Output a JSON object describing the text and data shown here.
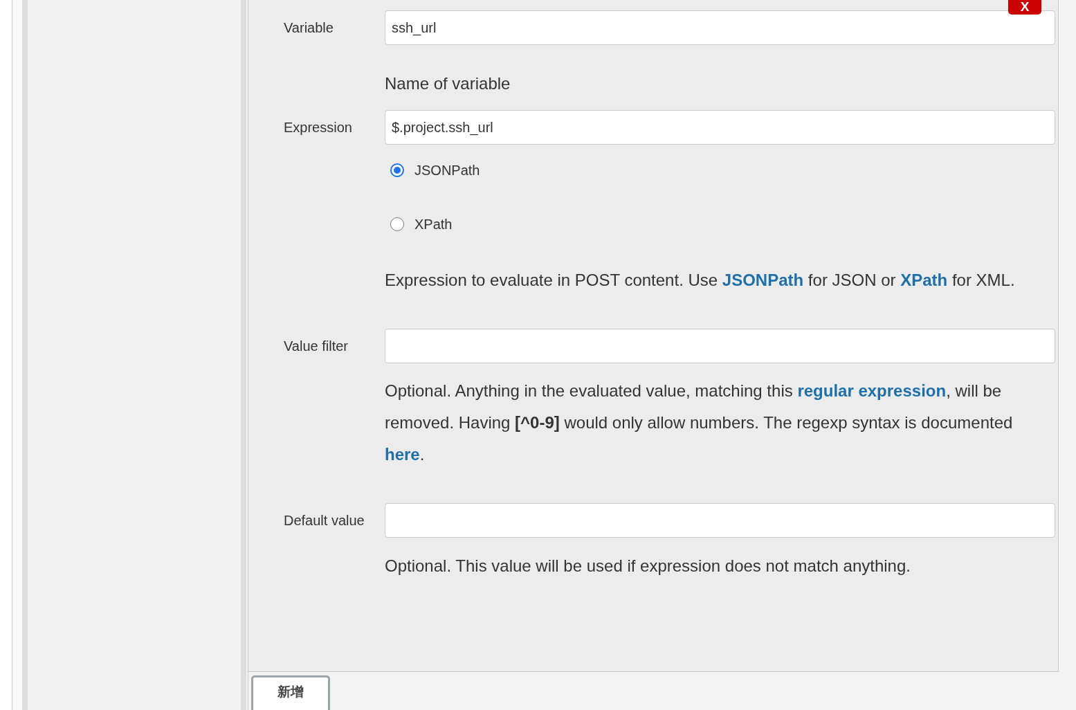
{
  "delete_button": {
    "label": "X"
  },
  "fields": [
    {
      "label": "Variable",
      "value": "ssh_url",
      "help": [
        {
          "kind": "text",
          "text": "Name of variable"
        }
      ]
    },
    {
      "label": "Expression",
      "value": "$.project.ssh_url",
      "options": [
        {
          "label": "JSONPath",
          "selected": true
        },
        {
          "label": "XPath",
          "selected": false
        }
      ],
      "help": [
        {
          "kind": "text",
          "text": "Expression to evaluate in POST content. Use "
        },
        {
          "kind": "link",
          "text": "JSONPath"
        },
        {
          "kind": "text",
          "text": " for JSON or "
        },
        {
          "kind": "link",
          "text": "XPath"
        },
        {
          "kind": "text",
          "text": " for XML."
        }
      ]
    },
    {
      "label": "Value filter",
      "help": [
        {
          "kind": "text",
          "text": "Optional. Anything in the evaluated value, matching this "
        },
        {
          "kind": "link",
          "text": "regular expression"
        },
        {
          "kind": "text",
          "text": ", will be removed. Having "
        },
        {
          "kind": "bold",
          "text": "[^0-9]"
        },
        {
          "kind": "text",
          "text": " would only allow numbers. The regexp syntax is documented "
        },
        {
          "kind": "link",
          "text": "here"
        },
        {
          "kind": "text",
          "text": "."
        }
      ]
    },
    {
      "label": "Default value",
      "help": [
        {
          "kind": "text",
          "text": "Optional. This value will be used if expression does not match anything."
        }
      ]
    }
  ],
  "add_button": {
    "label": "新增"
  }
}
